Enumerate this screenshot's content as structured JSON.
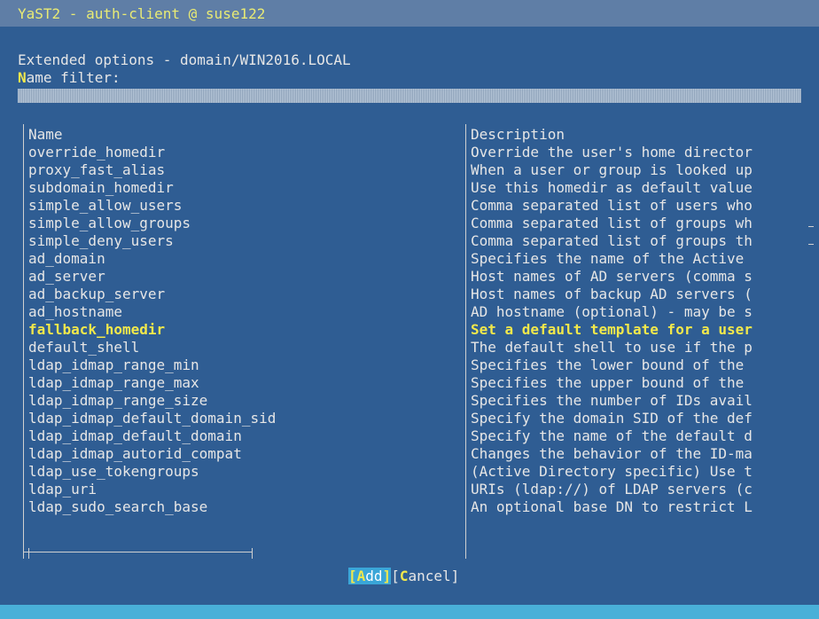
{
  "window": {
    "title": "YaST2 - auth-client @ suse122"
  },
  "dialog": {
    "heading": "Extended options - domain/WIN2016.LOCAL",
    "filter_hotkey": "N",
    "filter_label_rest": "ame filter:",
    "filter_value": ""
  },
  "table": {
    "columns": [
      "Name",
      "Description"
    ],
    "selected_index": 10,
    "rows": [
      {
        "name": "override_homedir",
        "description": "Override the user's home director"
      },
      {
        "name": "proxy_fast_alias",
        "description": "When a user or group is looked up"
      },
      {
        "name": "subdomain_homedir",
        "description": "Use this homedir as default value"
      },
      {
        "name": "simple_allow_users",
        "description": "Comma separated list of users who"
      },
      {
        "name": "simple_allow_groups",
        "description": "Comma separated list of groups wh"
      },
      {
        "name": "simple_deny_users",
        "description": "Comma separated list of groups th"
      },
      {
        "name": "ad_domain",
        "description": "Specifies the name of the Active"
      },
      {
        "name": "ad_server",
        "description": "Host names of AD servers (comma s"
      },
      {
        "name": "ad_backup_server",
        "description": "Host names of backup AD servers ("
      },
      {
        "name": "ad_hostname",
        "description": "AD hostname (optional) - may be s"
      },
      {
        "name": "fallback_homedir",
        "description": "Set a default template for a user"
      },
      {
        "name": "default_shell",
        "description": "The default shell to use if the p"
      },
      {
        "name": "ldap_idmap_range_min",
        "description": "Specifies the lower bound of the"
      },
      {
        "name": "ldap_idmap_range_max",
        "description": "Specifies the upper bound of the"
      },
      {
        "name": "ldap_idmap_range_size",
        "description": "Specifies the number of IDs avail"
      },
      {
        "name": "ldap_idmap_default_domain_sid",
        "description": "Specify the domain SID of the def"
      },
      {
        "name": "ldap_idmap_default_domain",
        "description": "Specify the name of the default d"
      },
      {
        "name": "ldap_idmap_autorid_compat",
        "description": "Changes the behavior of the ID-ma"
      },
      {
        "name": "ldap_use_tokengroups",
        "description": "(Active Directory specific) Use t"
      },
      {
        "name": "ldap_uri",
        "description": "URIs (ldap://) of LDAP servers (c"
      },
      {
        "name": "ldap_sudo_search_base",
        "description": "An optional base DN to restrict L"
      }
    ]
  },
  "buttons": {
    "add": {
      "open": "[",
      "hotkey": "A",
      "rest": "dd",
      "close": "]"
    },
    "cancel": {
      "open": "[",
      "hotkey": "C",
      "rest": "ancel",
      "close": "]"
    }
  },
  "colors": {
    "background": "#2f5d93",
    "titlebar": "#5f7ea6",
    "highlight": "#f2e84b",
    "active_button": "#3aa6d8",
    "statusbar": "#49b0d8"
  }
}
